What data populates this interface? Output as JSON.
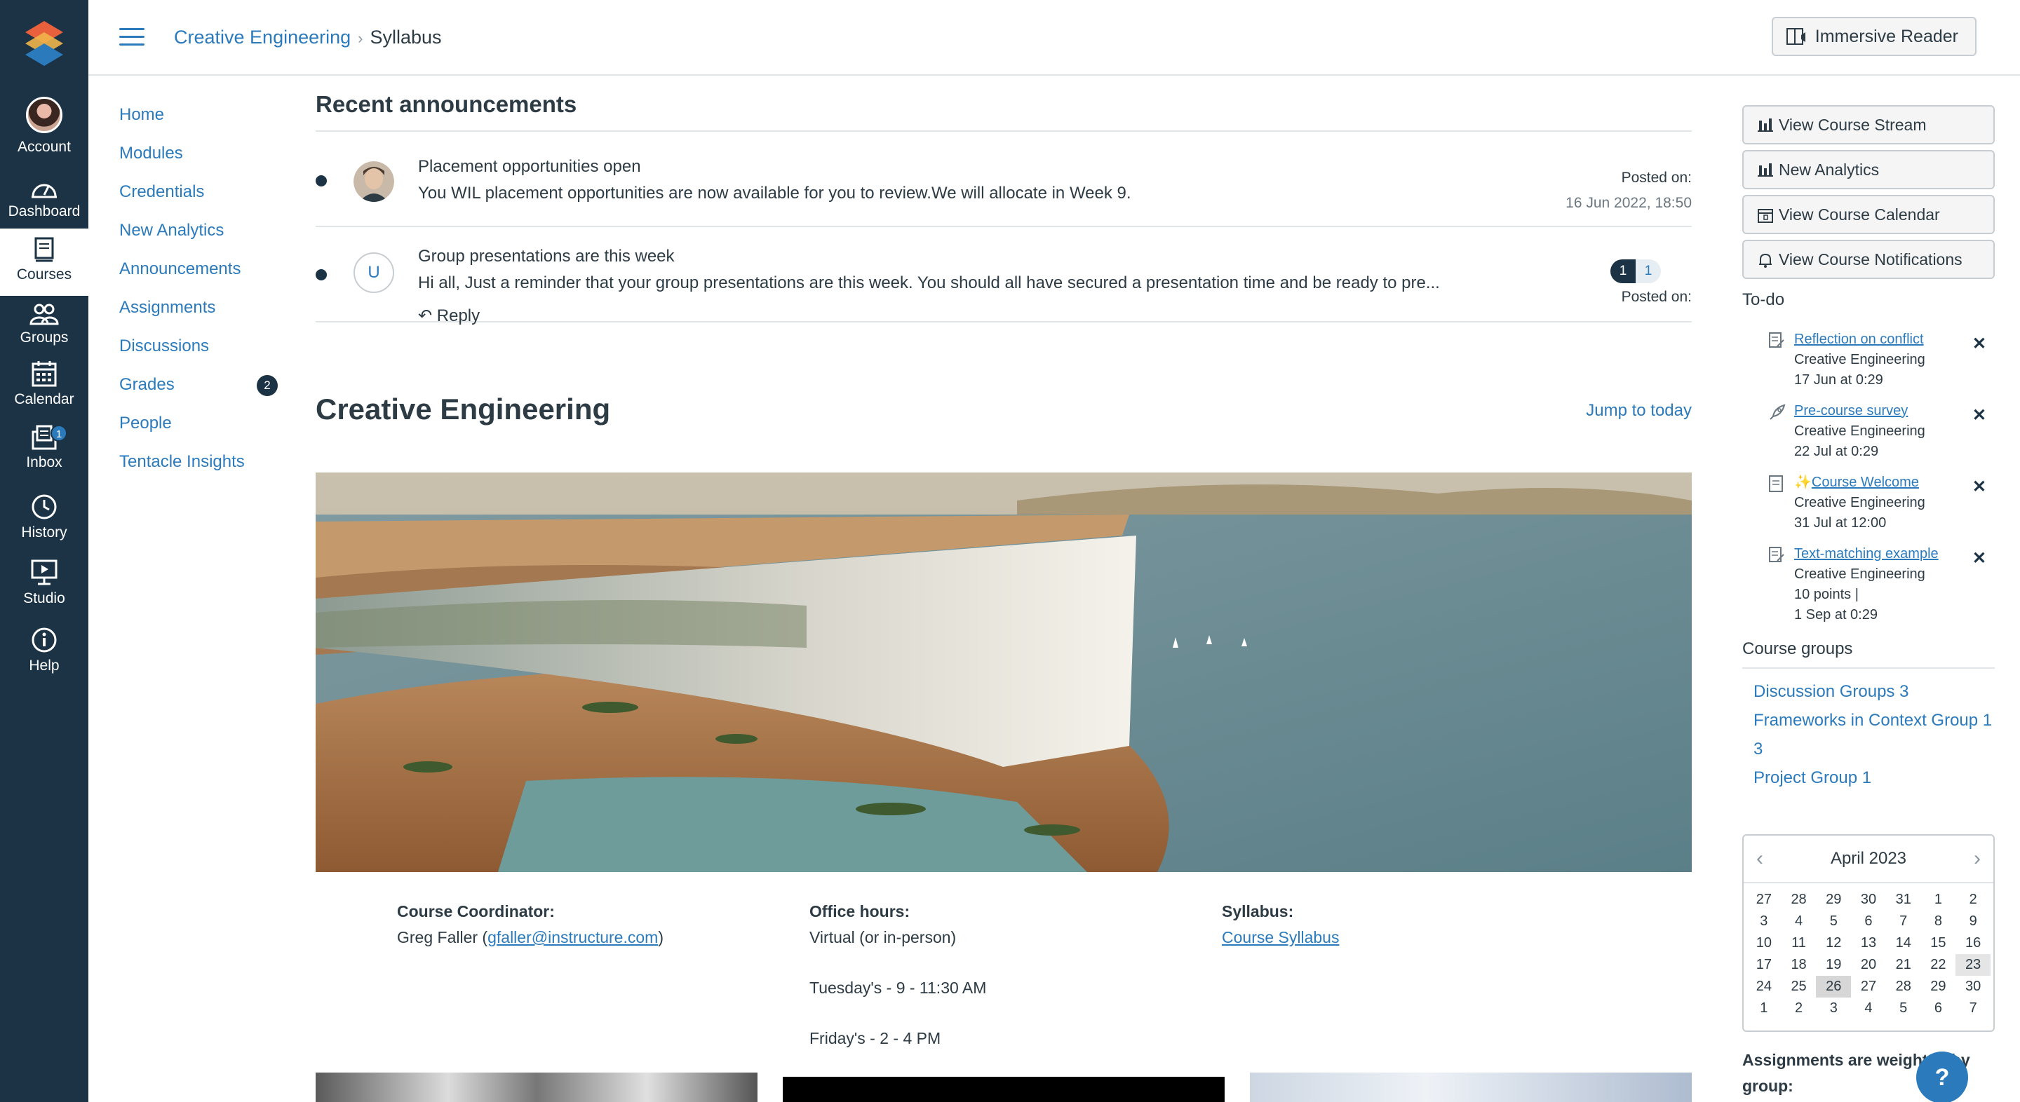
{
  "global_nav": {
    "items": [
      {
        "label": "Account",
        "icon": "avatar"
      },
      {
        "label": "Dashboard",
        "icon": "dashboard-icon"
      },
      {
        "label": "Courses",
        "icon": "courses-icon"
      },
      {
        "label": "Groups",
        "icon": "groups-icon"
      },
      {
        "label": "Calendar",
        "icon": "calendar-icon"
      },
      {
        "label": "Inbox",
        "icon": "inbox-icon",
        "badge": "1"
      },
      {
        "label": "History",
        "icon": "history-icon"
      },
      {
        "label": "Studio",
        "icon": "studio-icon"
      },
      {
        "label": "Help",
        "icon": "help-icon"
      }
    ]
  },
  "header": {
    "breadcrumb": [
      "Creative Engineering",
      "Syllabus"
    ],
    "immersive_reader": "Immersive Reader"
  },
  "course_nav": {
    "items": [
      "Home",
      "Modules",
      "Credentials",
      "New Analytics",
      "Announcements",
      "Assignments",
      "Discussions",
      "Grades",
      "People",
      "Tentacle Insights"
    ],
    "grades_badge": "2"
  },
  "announcements": {
    "heading": "Recent announcements",
    "items": [
      {
        "title": "Placement opportunities open",
        "body": "You WIL placement opportunities are now available for you to review.We will allocate in Week 9.",
        "posted_label": "Posted on:",
        "posted_date": "16 Jun 2022, 18:50"
      },
      {
        "title": "Group presentations are this week",
        "body": "Hi all, Just a reminder that your group presentations are this week. You should all have secured a presentation time and be ready to pre...",
        "avatar_letter": "U",
        "reply": "Reply",
        "unread_count": "1",
        "total_count": "1",
        "posted_label": "Posted on:"
      }
    ]
  },
  "course": {
    "title": "Creative Engineering",
    "jump_to_today": "Jump to today",
    "coordinator_label": "Course Coordinator:",
    "coordinator_name": "Greg Faller (",
    "coordinator_email": "gfaller@instructure.com",
    "coordinator_close": ")",
    "office_hours_label": "Office hours:",
    "office_hours_lines": [
      "Virtual (or in-person)",
      "Tuesday's - 9 - 11:30 AM",
      "Friday's - 2 - 4 PM"
    ],
    "syllabus_label": "Syllabus:",
    "syllabus_link": "Course Syllabus"
  },
  "sidebar": {
    "buttons": [
      "View Course Stream",
      "New Analytics",
      "View Course Calendar",
      "View Course Notifications"
    ],
    "todo_heading": "To-do",
    "todos": [
      {
        "title": "Reflection on conflict",
        "course": "Creative Engineering",
        "due": "17 Jun at 0:29"
      },
      {
        "title": "Pre-course survey",
        "course": "Creative Engineering",
        "due": "22 Jul at 0:29"
      },
      {
        "title": "Course Welcome",
        "course": "Creative Engineering",
        "due": "31 Jul at 12:00"
      },
      {
        "title": "Text-matching example",
        "course": "Creative Engineering",
        "points": "10 points  |",
        "due": "1 Sep at 0:29"
      }
    ],
    "groups_heading": "Course groups",
    "groups": [
      "Discussion Groups 3",
      "Frameworks in Context Group 1",
      "3",
      "Project Group 1"
    ],
    "calendar": {
      "month": "April 2023",
      "days": [
        "27",
        "28",
        "29",
        "30",
        "31",
        "1",
        "2",
        "3",
        "4",
        "5",
        "6",
        "7",
        "8",
        "9",
        "10",
        "11",
        "12",
        "13",
        "14",
        "15",
        "16",
        "17",
        "18",
        "19",
        "20",
        "21",
        "22",
        "23",
        "24",
        "25",
        "26",
        "27",
        "28",
        "29",
        "30",
        "1",
        "2",
        "3",
        "4",
        "5",
        "6",
        "7"
      ]
    },
    "weights_text": "Assignments are weighted by group:"
  },
  "colors": {
    "nav_bg": "#1b3345",
    "link": "#2b7abc",
    "text": "#2d3b45"
  }
}
